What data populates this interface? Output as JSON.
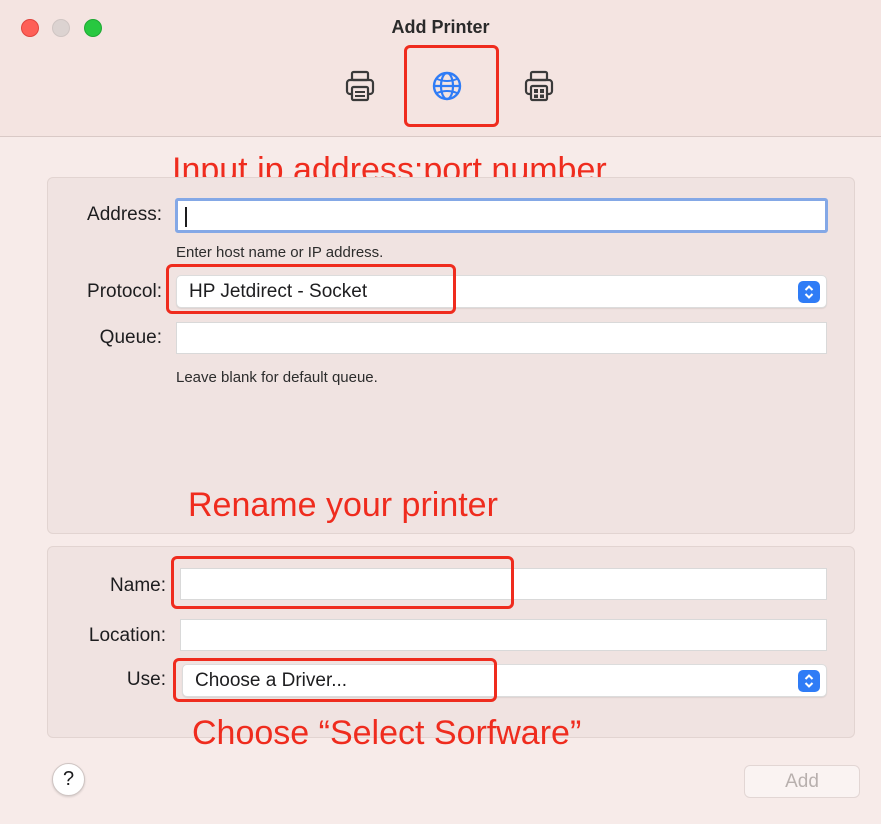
{
  "window": {
    "title": "Add Printer"
  },
  "toolbar": {
    "items": [
      {
        "icon": "printer-icon",
        "selected": false
      },
      {
        "icon": "globe-icon",
        "selected": true
      },
      {
        "icon": "windows-printer-icon",
        "selected": false
      }
    ]
  },
  "annotations": {
    "address_note": "Input ip address:port number",
    "name_note": "Rename your printer",
    "use_note": "Choose “Select Sorfware”",
    "highlight_color": "#ef2c1e"
  },
  "form": {
    "address": {
      "label": "Address:",
      "value": "",
      "hint": "Enter host name or IP address."
    },
    "protocol": {
      "label": "Protocol:",
      "value": "HP Jetdirect - Socket"
    },
    "queue": {
      "label": "Queue:",
      "value": "",
      "hint": "Leave blank for default queue."
    },
    "name": {
      "label": "Name:",
      "value": ""
    },
    "location": {
      "label": "Location:",
      "value": ""
    },
    "use": {
      "label": "Use:",
      "value": "Choose a Driver..."
    }
  },
  "buttons": {
    "help": "?",
    "add": "Add"
  },
  "colors": {
    "accent": "#2f7cf6",
    "close": "#fe5f57",
    "maximize": "#28c840"
  }
}
